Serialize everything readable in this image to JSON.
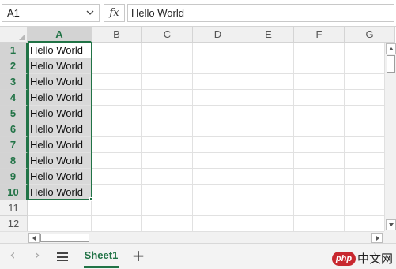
{
  "formula_bar": {
    "name_box": "A1",
    "fx_label": "fx",
    "formula_value": "Hello World"
  },
  "columns": [
    "A",
    "B",
    "C",
    "D",
    "E",
    "F",
    "G"
  ],
  "rows": [
    "1",
    "2",
    "3",
    "4",
    "5",
    "6",
    "7",
    "8",
    "9",
    "10",
    "11",
    "12"
  ],
  "cells": [
    [
      "Hello World",
      "",
      "",
      "",
      "",
      "",
      ""
    ],
    [
      "Hello World",
      "",
      "",
      "",
      "",
      "",
      ""
    ],
    [
      "Hello World",
      "",
      "",
      "",
      "",
      "",
      ""
    ],
    [
      "Hello World",
      "",
      "",
      "",
      "",
      "",
      ""
    ],
    [
      "Hello World",
      "",
      "",
      "",
      "",
      "",
      ""
    ],
    [
      "Hello World",
      "",
      "",
      "",
      "",
      "",
      ""
    ],
    [
      "Hello World",
      "",
      "",
      "",
      "",
      "",
      ""
    ],
    [
      "Hello World",
      "",
      "",
      "",
      "",
      "",
      ""
    ],
    [
      "Hello World",
      "",
      "",
      "",
      "",
      "",
      ""
    ],
    [
      "Hello World",
      "",
      "",
      "",
      "",
      "",
      ""
    ],
    [
      "",
      "",
      "",
      "",
      "",
      "",
      ""
    ],
    [
      "",
      "",
      "",
      "",
      "",
      "",
      ""
    ]
  ],
  "selection": {
    "active_cell": "A1",
    "range": "A1:A10"
  },
  "sheet_tabs": {
    "prev_label": "‹",
    "next_label": "›",
    "active_sheet": "Sheet1",
    "add_label": "+"
  },
  "watermark": {
    "badge": "php",
    "text": "中文网"
  },
  "colors": {
    "accent": "#217346",
    "selection_fill": "#d9d9d9",
    "header_bg": "#f0f0f0"
  }
}
